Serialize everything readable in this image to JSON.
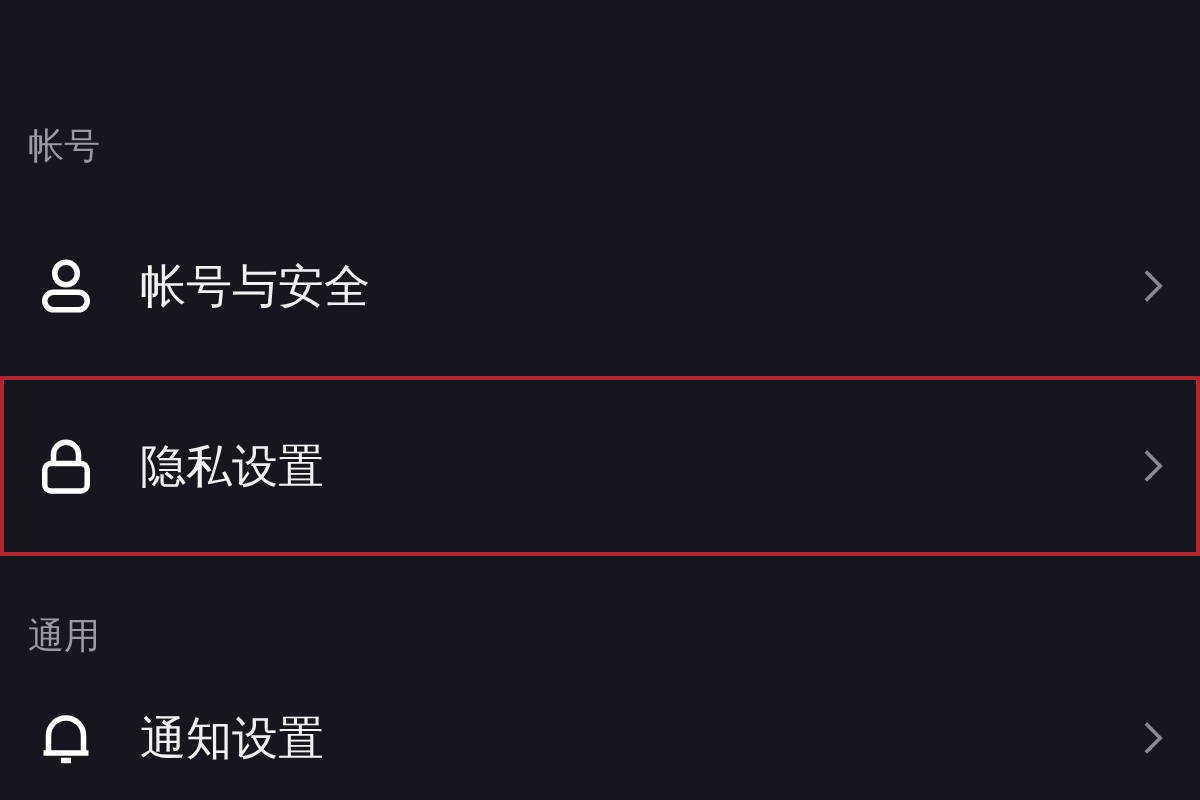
{
  "sections": [
    {
      "title": "帐号",
      "items": [
        {
          "label": "帐号与安全",
          "kind": "account",
          "highlighted": false
        },
        {
          "label": "隐私设置",
          "kind": "privacy",
          "highlighted": true
        }
      ]
    },
    {
      "title": "通用",
      "items": [
        {
          "label": "通知设置",
          "kind": "notification",
          "highlighted": false
        }
      ]
    }
  ]
}
